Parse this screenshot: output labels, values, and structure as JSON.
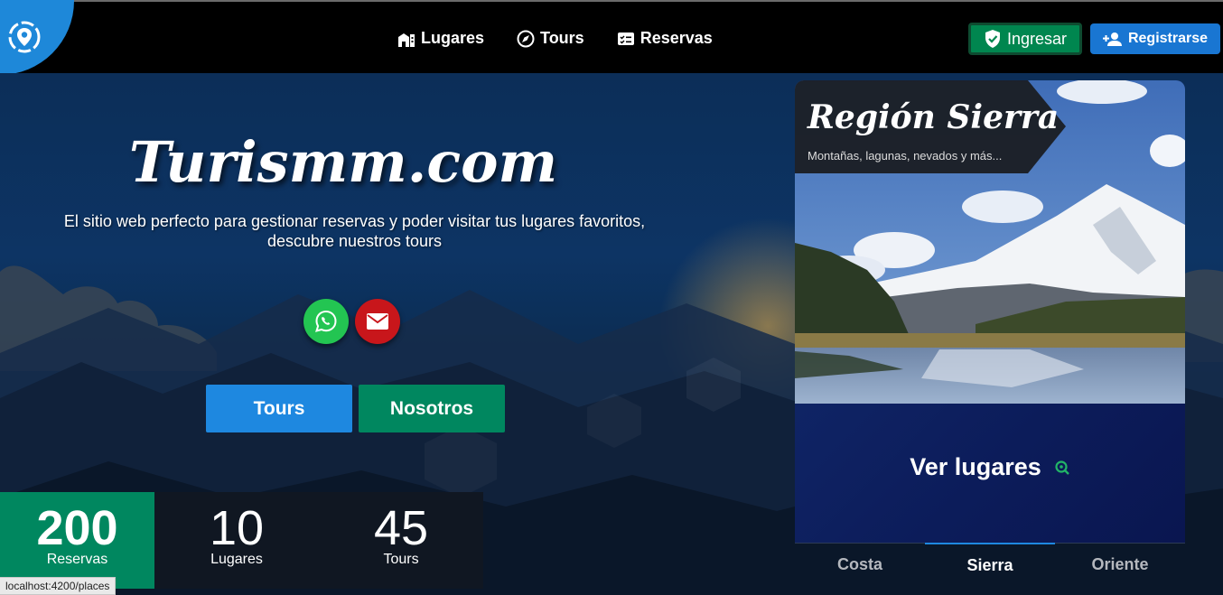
{
  "nav": {
    "links": [
      {
        "label": "Lugares",
        "icon": "city-icon"
      },
      {
        "label": "Tours",
        "icon": "compass-icon"
      },
      {
        "label": "Reservas",
        "icon": "booking-card-icon"
      }
    ],
    "login_label": "Ingresar",
    "register_label": "Registrarse"
  },
  "hero": {
    "title": "Turismm.com",
    "subtitle_line1": "El sitio web perfecto para gestionar reservas y poder visitar tus lugares favoritos,",
    "subtitle_line2": "descubre nuestros tours",
    "buttons": {
      "tours": "Tours",
      "about": "Nosotros"
    }
  },
  "stats": [
    {
      "value": "200",
      "label": "Reservas"
    },
    {
      "value": "10",
      "label": "Lugares"
    },
    {
      "value": "45",
      "label": "Tours"
    }
  ],
  "region_card": {
    "title": "Región Sierra",
    "subtitle": "Montañas, lagunas, nevados y más...",
    "cta": "Ver lugares"
  },
  "region_tabs": [
    "Costa",
    "Sierra",
    "Oriente"
  ],
  "active_tab": "Sierra",
  "status_bar": {
    "url": "localhost:4200/places"
  },
  "colors": {
    "brand_blue": "#1e88e0",
    "brand_green": "#00875f",
    "whatsapp": "#23c552",
    "mail": "#c8161b"
  }
}
